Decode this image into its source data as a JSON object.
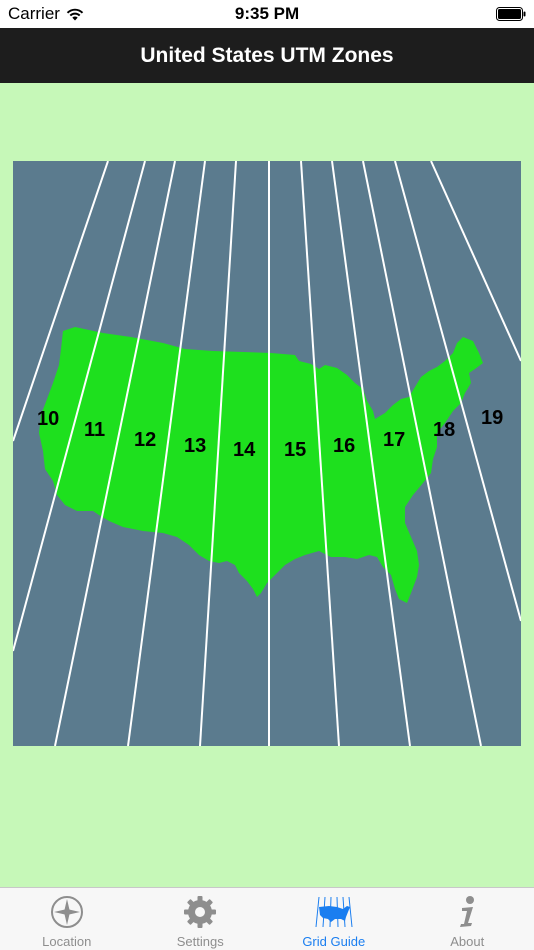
{
  "status_bar": {
    "carrier": "Carrier",
    "time": "9:35 PM"
  },
  "nav": {
    "title": "United States UTM Zones"
  },
  "map": {
    "zones": [
      "10",
      "11",
      "12",
      "13",
      "14",
      "15",
      "16",
      "17",
      "18",
      "19"
    ],
    "colors": {
      "water": "#5b7b8e",
      "land": "#1ee01e",
      "lines": "#ffffff",
      "page_background": "#c6f8b8"
    }
  },
  "tabs": [
    {
      "label": "Location",
      "icon": "compass-icon",
      "active": false
    },
    {
      "label": "Settings",
      "icon": "gear-icon",
      "active": false
    },
    {
      "label": "Grid Guide",
      "icon": "us-map-icon",
      "active": true
    },
    {
      "label": "About",
      "icon": "info-icon",
      "active": false
    }
  ],
  "colors": {
    "active_tab": "#1a7ef0",
    "inactive_tab": "#8e8e8e",
    "nav_background": "#1d1d1d"
  }
}
